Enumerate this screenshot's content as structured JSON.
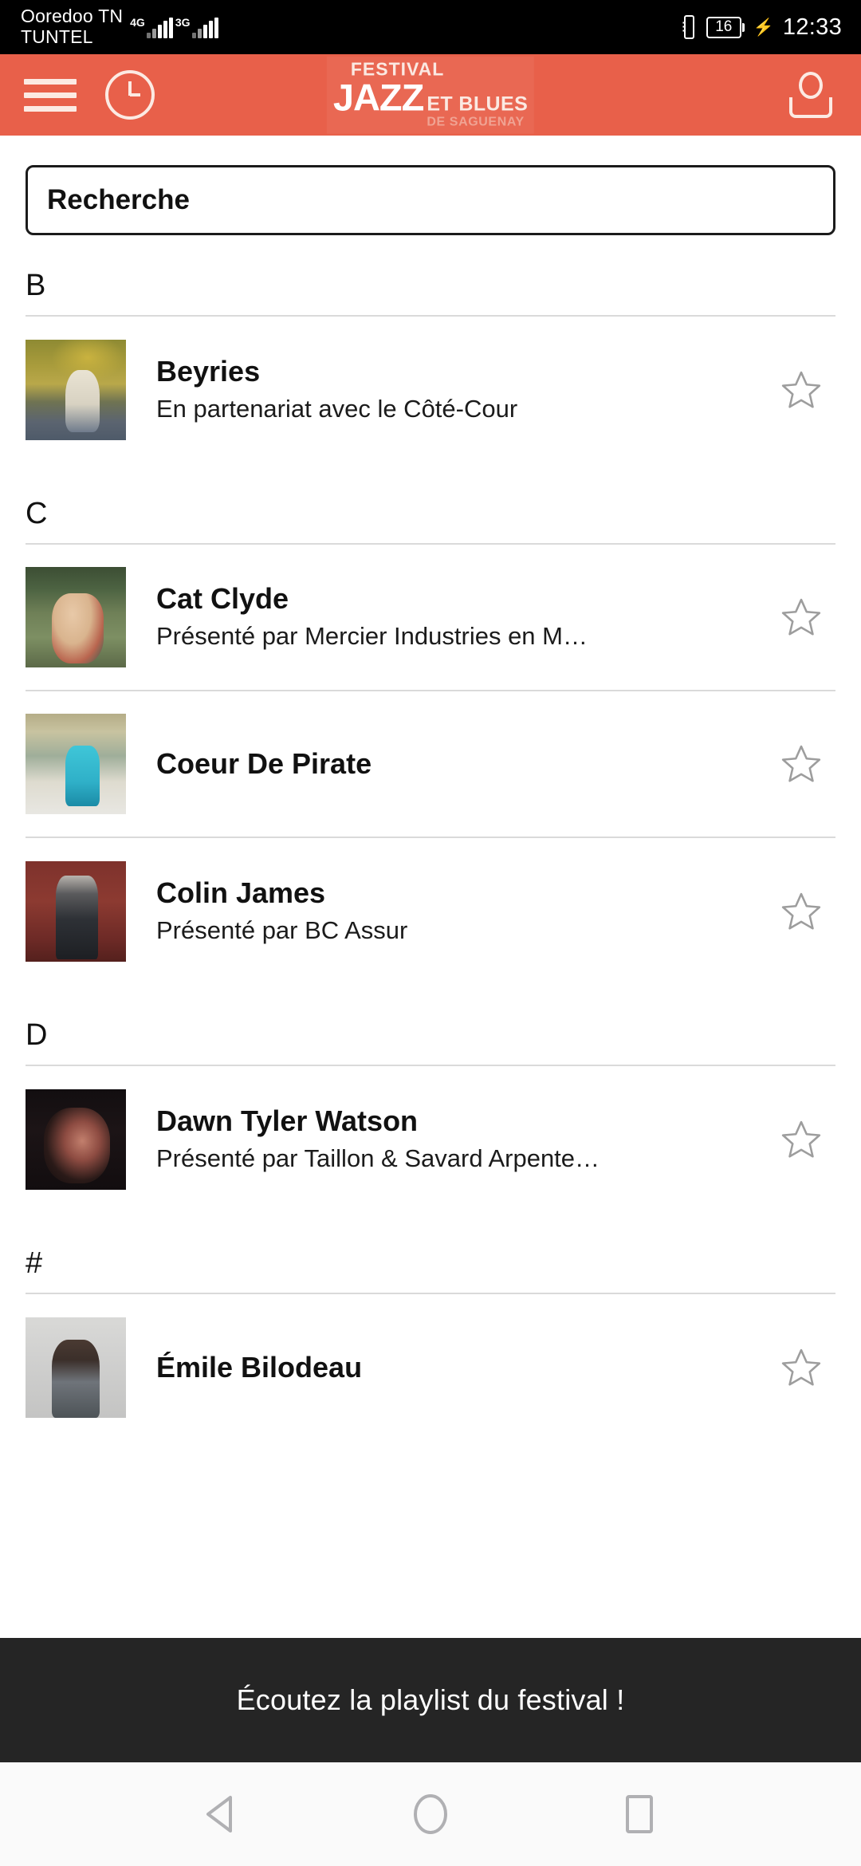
{
  "status_bar": {
    "carrier_line1": "Ooredoo TN",
    "carrier_line2": "TUNTEL",
    "network_1": "4G",
    "network_2": "3G",
    "vibrate_icon": "vibrate-icon",
    "battery_level": "16",
    "charging_icon": "charging-bolt-icon",
    "time": "12:33"
  },
  "header": {
    "menu_icon": "hamburger-menu-icon",
    "clock_icon": "clock-icon",
    "account_icon": "account-person-icon",
    "logo": {
      "line_festival": "FESTIVAL",
      "line_jazz": "JAZZ",
      "line_et_blues": "ET BLUES",
      "line_de_saguenay": "DE SAGUENAY"
    },
    "background_color": "#e8604a"
  },
  "search": {
    "placeholder": "Recherche",
    "value": ""
  },
  "sections": [
    {
      "letter": "B",
      "artists": [
        {
          "name": "Beyries",
          "subtitle": "En partenariat avec le Côté-Cour",
          "photo": "ph-beyries",
          "favorite_icon": "star-outline-icon"
        }
      ]
    },
    {
      "letter": "C",
      "artists": [
        {
          "name": "Cat Clyde",
          "subtitle": "Présenté par Mercier Industries en M…",
          "photo": "ph-catclyde",
          "favorite_icon": "star-outline-icon"
        },
        {
          "name": "Coeur De Pirate",
          "subtitle": "",
          "photo": "ph-coeur",
          "favorite_icon": "star-outline-icon"
        },
        {
          "name": "Colin James",
          "subtitle": "Présenté par BC Assur",
          "photo": "ph-colin",
          "favorite_icon": "star-outline-icon"
        }
      ]
    },
    {
      "letter": "D",
      "artists": [
        {
          "name": "Dawn Tyler Watson",
          "subtitle": "Présenté par Taillon & Savard Arpente…",
          "photo": "ph-dawn",
          "favorite_icon": "star-outline-icon"
        }
      ]
    },
    {
      "letter": "#",
      "artists": [
        {
          "name": "Émile Bilodeau",
          "subtitle": "",
          "photo": "ph-emile",
          "favorite_icon": "star-outline-icon"
        }
      ]
    }
  ],
  "playlist_banner": {
    "label": "Écoutez la playlist du festival !",
    "background_color": "#252525"
  },
  "navbar": {
    "back_icon": "back-triangle-icon",
    "home_icon": "home-circle-icon",
    "recents_icon": "recents-square-icon"
  }
}
